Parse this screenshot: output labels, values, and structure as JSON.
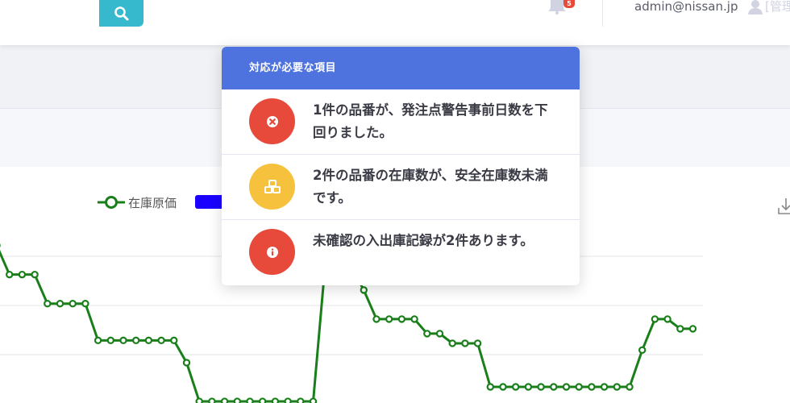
{
  "topbar": {
    "search_placeholder": "",
    "search_icon": "search-icon",
    "alerts_count": "5",
    "user_email": "admin@nissan.jp",
    "user_role_fragment": "[管理",
    "colors": {
      "search_button": "#36b9cc",
      "badge": "#e74a3b"
    }
  },
  "chart_legend": {
    "series_label": "在庫原価",
    "colors": {
      "series_line": "#1a7f1a",
      "second_series": "#1a00ff"
    }
  },
  "alerts": {
    "header": "対応が必要な項目",
    "header_color": "#4e73df",
    "items": [
      {
        "icon": "times-circle-icon",
        "color": "#e74a3b",
        "text": "1件の品番が、発注点警告事前日数を下回りました。"
      },
      {
        "icon": "cubes-icon",
        "color": "#f6c23e",
        "text": "2件の品番の在庫数が、安全在庫数未満です。"
      },
      {
        "icon": "info-icon",
        "color": "#e74a3b",
        "text": "未確認の入出庫記録が2件あります。"
      }
    ]
  },
  "chart_data": {
    "type": "line",
    "series": [
      {
        "name": "在庫原価",
        "x": [
          0,
          1,
          2,
          3,
          4,
          5,
          6,
          7,
          8,
          9,
          10,
          11,
          12,
          13,
          14,
          15,
          16,
          17,
          18,
          19,
          20,
          21,
          22,
          23,
          24,
          25,
          26,
          27,
          28,
          29,
          30,
          31,
          32,
          33,
          34,
          35,
          36,
          37,
          38,
          39,
          40,
          41,
          42,
          43,
          44,
          45,
          46,
          47,
          48,
          49,
          50,
          51,
          52,
          53,
          54,
          55
        ],
        "values": [
          146,
          116,
          116,
          116,
          86,
          86,
          86,
          86,
          48,
          48,
          48,
          48,
          48,
          48,
          48,
          25,
          -15,
          -15,
          -15,
          -15,
          -15,
          -15,
          -15,
          -15,
          -15,
          -15,
          134,
          124,
          124,
          100,
          70,
          70,
          70,
          70,
          55,
          55,
          45,
          45,
          45,
          0,
          0,
          0,
          0,
          0,
          0,
          0,
          0,
          0,
          0,
          0,
          0,
          38,
          70,
          70,
          60,
          60
        ]
      }
    ],
    "ylim": [
      0,
      200
    ],
    "grid": true
  }
}
